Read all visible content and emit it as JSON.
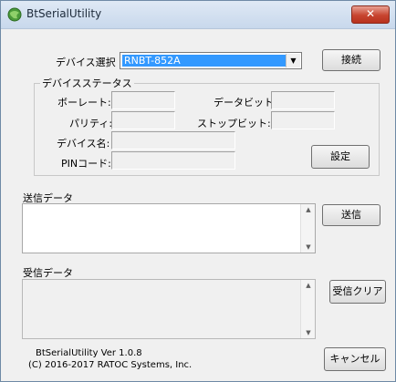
{
  "window": {
    "title": "BtSerialUtility",
    "close_label": "✕"
  },
  "device": {
    "label": "デバイス選択",
    "selected": "RNBT-852A",
    "connect_label": "接続"
  },
  "status": {
    "legend": "デバイスステータス",
    "baudrate_label": "ボーレート:",
    "databits_label": "データビット:",
    "parity_label": "パリティ:",
    "stopbits_label": "ストップビット:",
    "devicename_label": "デバイス名:",
    "pincode_label": "PINコード:",
    "settings_label": "設定"
  },
  "send": {
    "label": "送信データ",
    "value": "",
    "button_label": "送信"
  },
  "receive": {
    "label": "受信データ",
    "value": "",
    "clear_label": "受信クリア"
  },
  "footer": {
    "version": "BtSerialUtility  Ver 1.0.8",
    "copyright": "(C) 2016-2017 RATOC Systems, Inc.",
    "cancel_label": "キャンセル"
  },
  "colors": {
    "selection": "#3399ff",
    "close_button": "#c7442f",
    "window_bg": "#f0f0f0"
  },
  "icons": {
    "app": "bluetooth-globe-icon",
    "close": "close-icon",
    "dropdown": "chevron-down-icon",
    "scroll_up": "scroll-up-icon",
    "scroll_down": "scroll-down-icon"
  }
}
